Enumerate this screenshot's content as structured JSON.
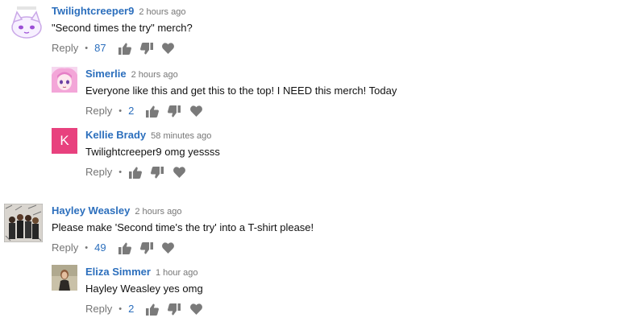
{
  "comments": [
    {
      "author": "Twilightcreeper9",
      "time": "2 hours ago",
      "text": "\"Second times the try\" merch?",
      "reply_label": "Reply",
      "likes": "87",
      "avatar": "cat-avatar",
      "replies": [
        {
          "author": "Simerlie",
          "time": "2 hours ago",
          "text": "Everyone like this and get this to the top! I NEED this merch! Today",
          "reply_label": "Reply",
          "likes": "2",
          "avatar": "anime-girl-avatar"
        },
        {
          "author": "Kellie Brady",
          "time": "58 minutes ago",
          "text": "Twilightcreeper9  omg yessss",
          "reply_label": "Reply",
          "likes": "",
          "avatar_letter": "K",
          "avatar_color": "#e8417e"
        }
      ]
    },
    {
      "author": "Hayley Weasley",
      "time": "2 hours ago",
      "text": "Please make 'Second time's the try' into a T-shirt please!",
      "reply_label": "Reply",
      "likes": "49",
      "avatar": "group-photo-avatar",
      "replies": [
        {
          "author": "Eliza Simmer",
          "time": "1 hour ago",
          "text": "Hayley Weasley yes omg",
          "reply_label": "Reply",
          "likes": "2",
          "avatar": "person-photo-avatar"
        }
      ]
    }
  ],
  "colors": {
    "author": "#2c6fbd",
    "muted": "#767676",
    "icon": "#7a7a7a",
    "k_avatar": "#e8417e"
  }
}
